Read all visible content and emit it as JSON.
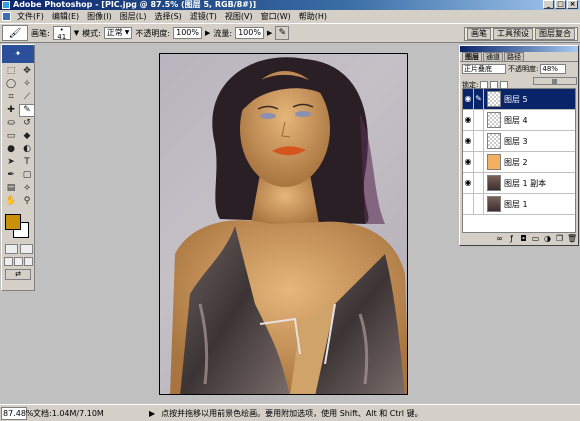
{
  "window": {
    "title": "Adobe Photoshop - [PIC.jpg @ 87.5% (图层 5, RGB/8#)]",
    "controls": [
      "_",
      "□",
      "×"
    ]
  },
  "menubar": {
    "items": [
      "文件(F)",
      "编辑(E)",
      "图像(I)",
      "图层(L)",
      "选择(S)",
      "滤镜(T)",
      "视图(V)",
      "窗口(W)",
      "帮助(H)"
    ]
  },
  "options": {
    "brush_label": "画笔:",
    "brush_size": "41",
    "mode_label": "模式:",
    "mode_value": "正常",
    "opacity_label": "不透明度:",
    "opacity_value": "100%",
    "flow_label": "流量:",
    "flow_value": "100%",
    "palette_well": [
      "画笔",
      "工具预设",
      "图层复合"
    ]
  },
  "colors": {
    "foreground": "#c9900a",
    "background": "#ffffff"
  },
  "layers_palette": {
    "tabs": [
      "图层",
      "通道",
      "路径"
    ],
    "blend_mode": "正片叠底",
    "opacity_label": "不透明度:",
    "opacity_value": "48%",
    "opacity_fraction": 0.48,
    "lock_label": "锁定:",
    "layers": [
      {
        "name": "图层 5",
        "visible": true,
        "selected": true,
        "thumb": "checker"
      },
      {
        "name": "图层 4",
        "visible": true,
        "selected": false,
        "thumb": "checker"
      },
      {
        "name": "图层 3",
        "visible": true,
        "selected": false,
        "thumb": "checker"
      },
      {
        "name": "图层 2",
        "visible": true,
        "selected": false,
        "thumb": "orange"
      },
      {
        "name": "图层 1 副本",
        "visible": true,
        "selected": false,
        "thumb": "photo"
      },
      {
        "name": "图层 1",
        "visible": false,
        "selected": false,
        "thumb": "photo"
      }
    ]
  },
  "statusbar": {
    "zoom": "87.48%",
    "doc_info": "文档:1.04M/7.10M",
    "hint": "点按并拖移以用前景色绘画。要用附加选项，使用 Shift、Alt 和 Ctrl 键。"
  }
}
